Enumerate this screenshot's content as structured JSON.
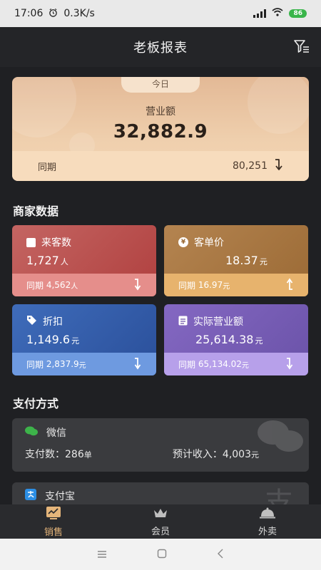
{
  "status": {
    "time": "17:06",
    "speed": "0.3K/s",
    "battery": "86"
  },
  "header": {
    "title": "老板报表"
  },
  "today": {
    "tab": "今日",
    "revenue_label": "营业额",
    "revenue_value": "32,882.9",
    "compare_label": "同期",
    "compare_value": "80,251",
    "trend": "down"
  },
  "merchant": {
    "section_title": "商家数据",
    "cards": [
      {
        "label": "来客数",
        "value": "1,727",
        "unit": "人",
        "compare_label": "同期",
        "compare_value": "4,562",
        "compare_unit": "人",
        "trend": "down",
        "icon": "calendar-check-icon",
        "color": "#c75d5a"
      },
      {
        "label": "客单价",
        "value": "18.37",
        "unit": "元",
        "compare_label": "同期",
        "compare_value": "16.97",
        "compare_unit": "元",
        "trend": "up",
        "icon": "yen-coin-icon",
        "color": "#c08b4e"
      },
      {
        "label": "折扣",
        "value": "1,149.6",
        "unit": "元",
        "compare_label": "同期",
        "compare_value": "2,837.9",
        "compare_unit": "元",
        "trend": "down",
        "icon": "tag-icon",
        "color": "#3d64b3"
      },
      {
        "label": "实际营业额",
        "value": "25,614.38",
        "unit": "元",
        "compare_label": "同期",
        "compare_value": "65,134.02",
        "compare_unit": "元",
        "trend": "down",
        "icon": "clipboard-icon",
        "color": "#7a62b8"
      }
    ]
  },
  "payment": {
    "section_title": "支付方式",
    "methods": [
      {
        "name": "微信",
        "count_label": "支付数：",
        "count": "286",
        "count_unit": "单",
        "income_label": "预计收入：",
        "income": "4,003",
        "income_unit": "元",
        "icon": "wechat-icon"
      },
      {
        "name": "支付宝",
        "icon": "alipay-icon"
      }
    ]
  },
  "nav": {
    "items": [
      {
        "label": "销售",
        "icon": "sales-chart-icon",
        "active": true
      },
      {
        "label": "会员",
        "icon": "crown-icon",
        "active": false
      },
      {
        "label": "外卖",
        "icon": "cloche-icon",
        "active": false
      }
    ]
  }
}
